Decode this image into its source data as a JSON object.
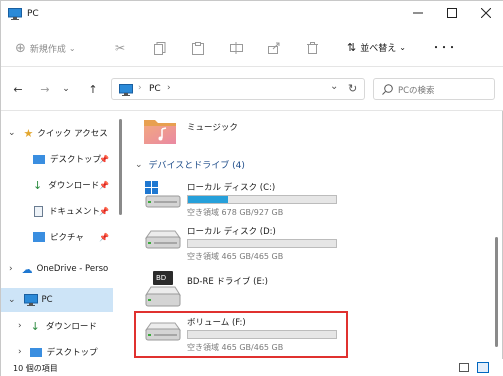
{
  "window": {
    "title": "PC"
  },
  "toolbar": {
    "new_label": "新規作成",
    "sort_label": "並べ替え",
    "more": "・・・"
  },
  "address": {
    "location": "PC",
    "search_placeholder": "PCの検索"
  },
  "nav": {
    "quick_access": "クイック アクセス",
    "items": [
      {
        "label": "デスクトップ"
      },
      {
        "label": "ダウンロード"
      },
      {
        "label": "ドキュメント"
      },
      {
        "label": "ピクチャ"
      }
    ],
    "onedrive": "OneDrive - Perso",
    "pc": "PC",
    "pc_children": [
      {
        "label": "ダウンロード"
      },
      {
        "label": "デスクトップ"
      }
    ]
  },
  "main": {
    "music": "ミュージック",
    "section": "デバイスとドライブ (4)",
    "drives": [
      {
        "name": "ローカル ディスク (C:)",
        "free": "空き領域 678 GB/927 GB",
        "used_fraction": 0.27
      },
      {
        "name": "ローカル ディスク (D:)",
        "free": "空き領域 465 GB/465 GB",
        "used_fraction": 0.0
      },
      {
        "name": "BD-RE ドライブ (E:)",
        "free": ""
      },
      {
        "name": "ボリューム (F:)",
        "free": "空き領域 465 GB/465 GB",
        "used_fraction": 0.0
      }
    ],
    "bd_badge": "BD"
  },
  "status": {
    "count": "10 個の項目"
  },
  "colors": {
    "accent": "#0067c0",
    "highlight": "#e0312f",
    "bar_fill": "#26a0da",
    "nav_selected": "#cde4f7"
  }
}
